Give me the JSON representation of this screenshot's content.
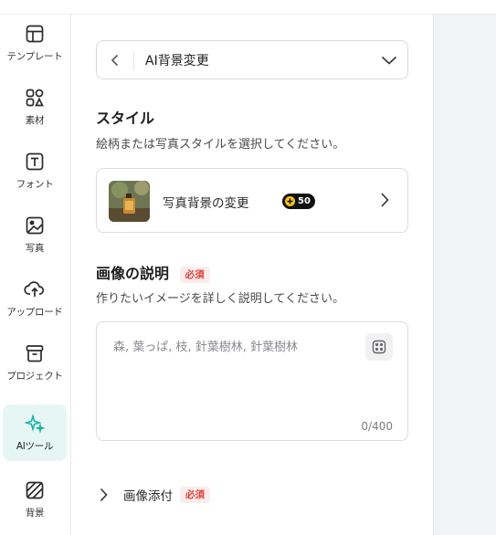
{
  "sidebar": {
    "items": [
      {
        "label": "テンプレート",
        "icon": "template-icon",
        "active": false
      },
      {
        "label": "素材",
        "icon": "elements-icon",
        "active": false
      },
      {
        "label": "フォント",
        "icon": "text-icon",
        "active": false
      },
      {
        "label": "写真",
        "icon": "photo-icon",
        "active": false
      },
      {
        "label": "アップロード",
        "icon": "upload-icon",
        "active": false
      },
      {
        "label": "プロジェクト",
        "icon": "project-icon",
        "active": false
      },
      {
        "label": "AIツール",
        "icon": "ai-sparkle-icon",
        "active": true
      },
      {
        "label": "背景",
        "icon": "background-icon",
        "active": false
      }
    ]
  },
  "tool_select": {
    "value": "AI背景変更"
  },
  "style_section": {
    "title": "スタイル",
    "description": "絵柄または写真スタイルを選択してください。",
    "card": {
      "name": "写真背景の変更",
      "credits": "50"
    }
  },
  "prompt_section": {
    "title": "画像の説明",
    "required": "必須",
    "description": "作りたいイメージを詳しく説明してください。",
    "placeholder": "森, 葉っぱ, 枝, 針葉樹林, 針葉樹林",
    "counter": "0/400"
  },
  "attach_section": {
    "label": "画像添付",
    "required": "必須"
  },
  "colors": {
    "accent": "#19b3a8",
    "active_bg": "#e6f6f5",
    "required_text": "#e0413a",
    "required_bg": "#fdecec"
  }
}
